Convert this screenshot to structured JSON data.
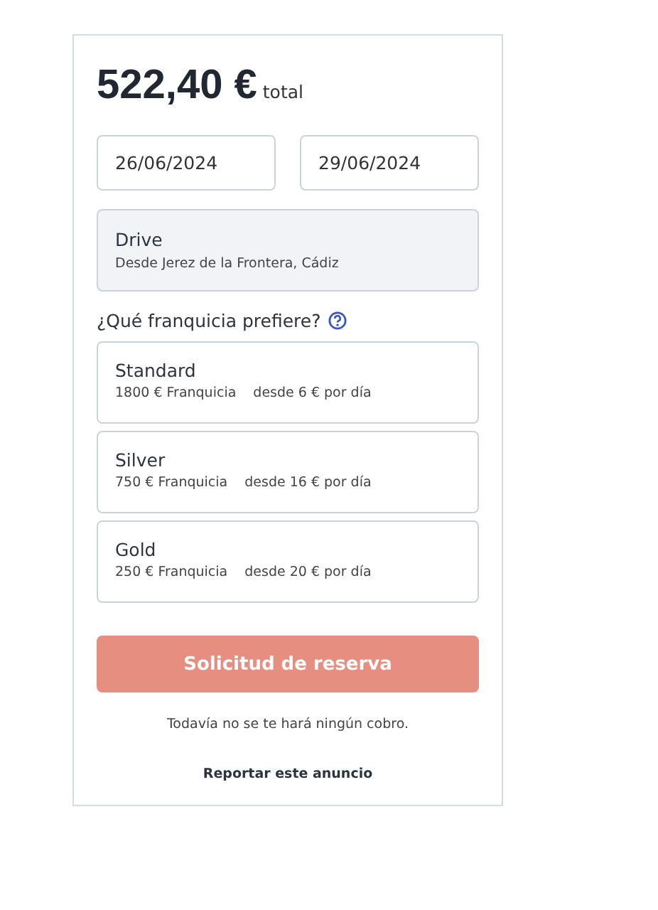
{
  "price": {
    "amount": "522,40 €",
    "suffix": "total"
  },
  "dates": [
    {
      "value": "26/06/2024"
    },
    {
      "value": "29/06/2024"
    }
  ],
  "location": {
    "title": "Drive",
    "subtitle": "Desde Jerez de la Frontera, Cádiz"
  },
  "question": "¿Qué franquicia prefiere?",
  "options": [
    {
      "name": "Standard",
      "deductible": "1800 € Franquicia",
      "price": "desde 6 € por día",
      "selected": false
    },
    {
      "name": "Silver",
      "deductible": "750 € Franquicia",
      "price": "desde 16 € por día",
      "selected": false
    },
    {
      "name": "Gold",
      "deductible": "250 € Franquicia",
      "price": "desde 20 € por día",
      "selected": false
    }
  ],
  "submit": {
    "label": "Solicitud de reserva",
    "disabled": true
  },
  "note": "Todavía no se te hará ningún cobro.",
  "report_link": "Reportar este anuncio"
}
